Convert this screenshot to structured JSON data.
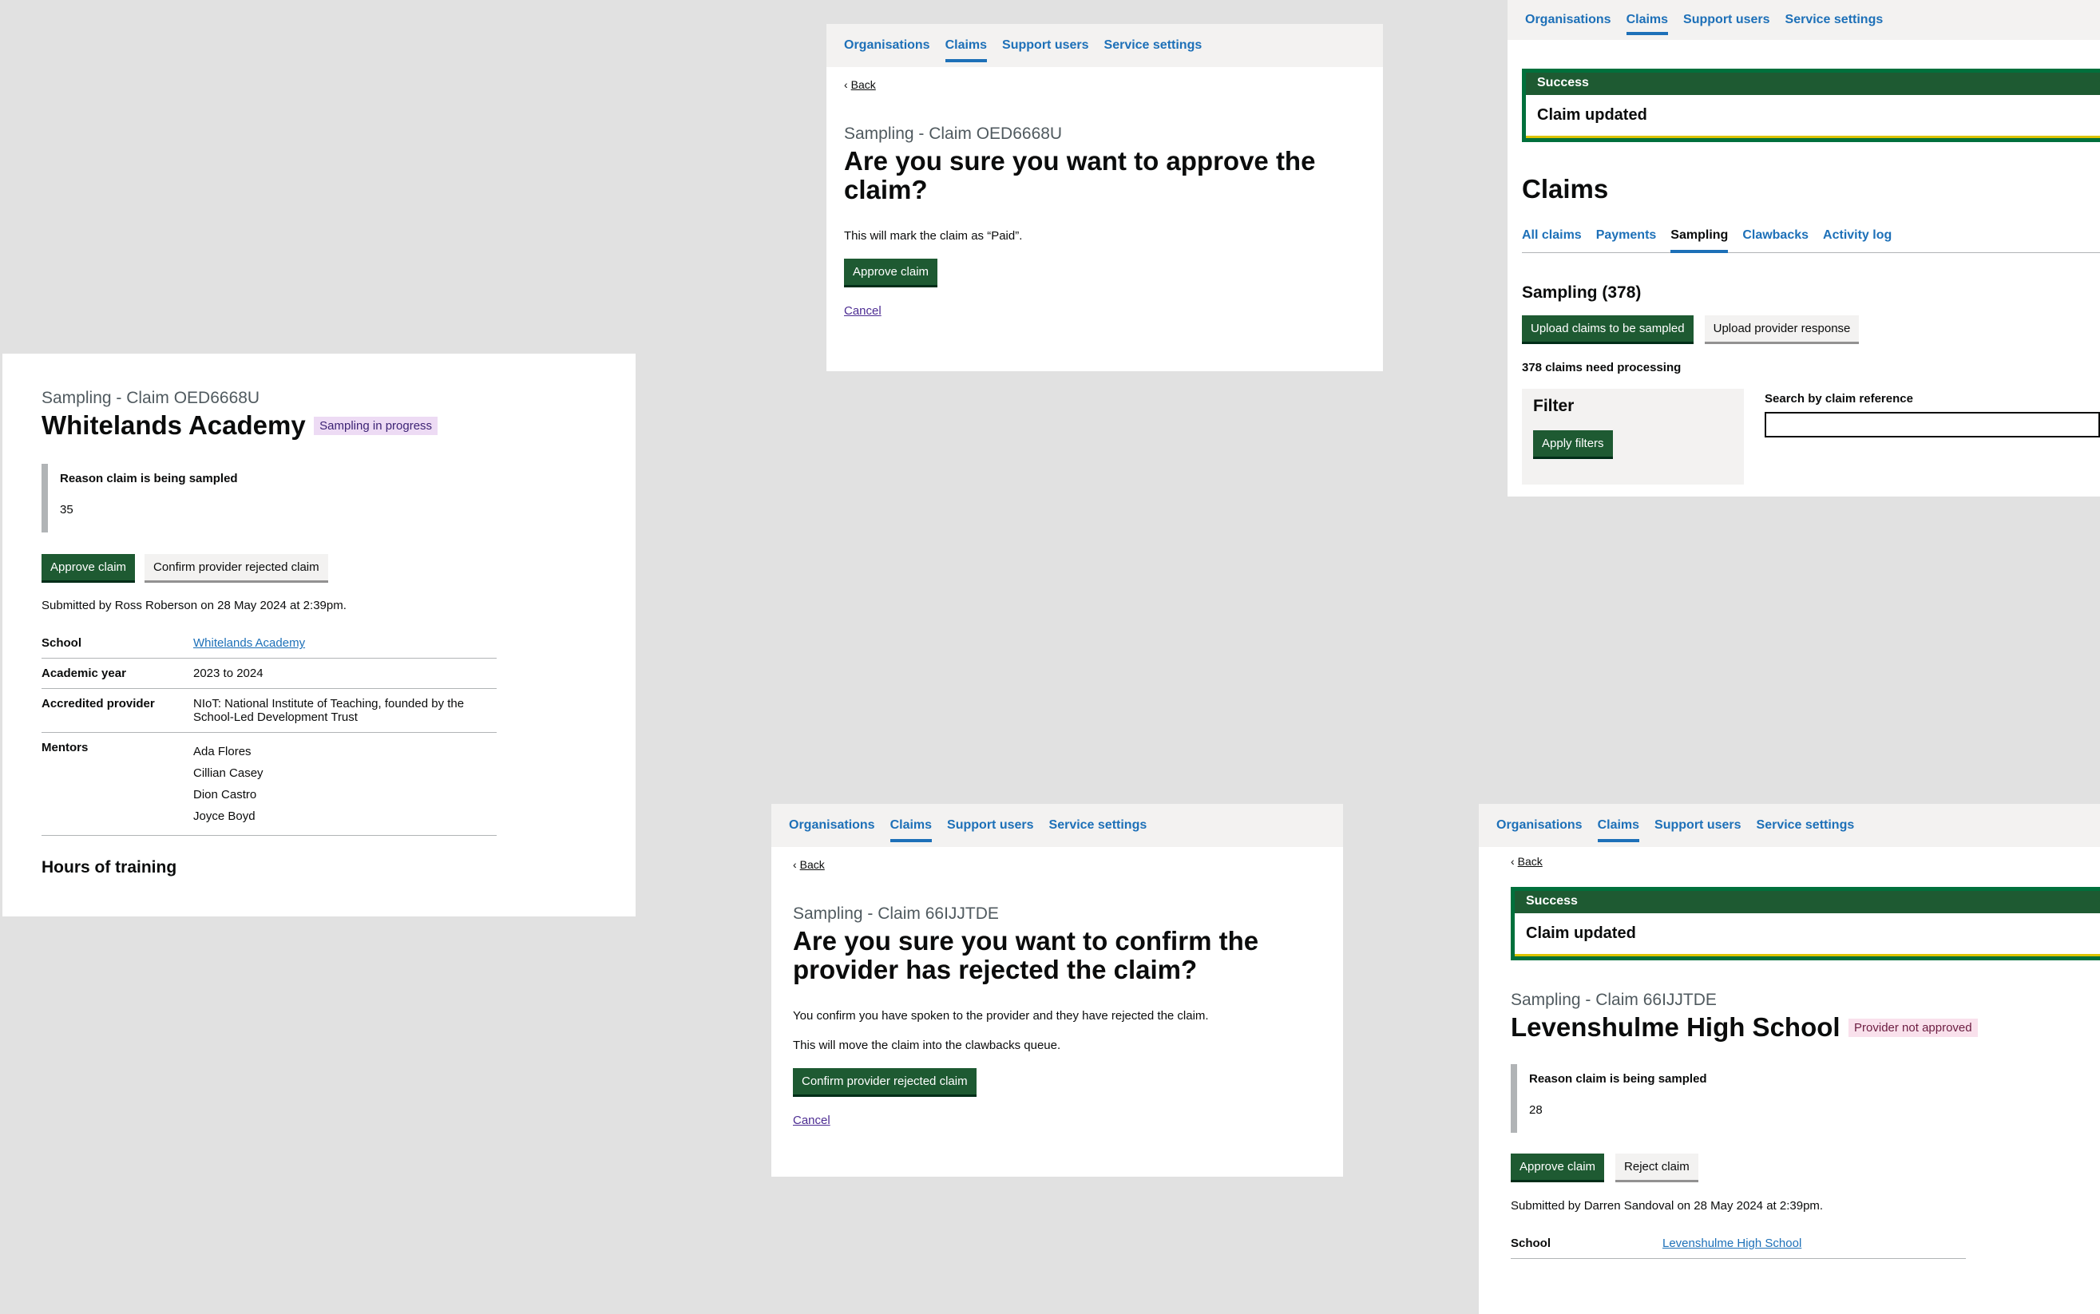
{
  "nav": {
    "organisations": "Organisations",
    "claims": "Claims",
    "support_users": "Support users",
    "service_settings": "Service settings"
  },
  "claim_detail_1": {
    "caption": "Sampling - Claim OED6668U",
    "title": "Whitelands Academy",
    "status_tag": "Sampling in progress",
    "reason_heading": "Reason claim is being sampled",
    "reason_value": "35",
    "approve_label": "Approve claim",
    "reject_label": "Confirm provider rejected claim",
    "submitted": "Submitted by Ross Roberson on 28 May 2024 at 2:39pm.",
    "rows": [
      {
        "key": "School",
        "value": "Whitelands Academy"
      },
      {
        "key": "Academic year",
        "value": "2023 to 2024"
      },
      {
        "key": "Accredited provider",
        "value": "NIoT: National Institute of Teaching, founded by the School-Led Development Trust"
      },
      {
        "key": "Mentors",
        "values": [
          "Ada Flores",
          "Cillian Casey",
          "Dion Castro",
          "Joyce Boyd"
        ]
      }
    ],
    "hours_heading": "Hours of training"
  },
  "approve_confirm": {
    "back": "Back",
    "caption": "Sampling - Claim OED6668U",
    "title": "Are you sure you want to approve the claim?",
    "body": "This will mark the claim as “Paid”.",
    "button": "Approve claim",
    "cancel": "Cancel"
  },
  "claims_list": {
    "banner_title": "Success",
    "banner_body": "Claim updated",
    "heading": "Claims",
    "tabs": [
      "All claims",
      "Payments",
      "Sampling",
      "Clawbacks",
      "Activity log"
    ],
    "active_tab": "Sampling",
    "section_heading": "Sampling (378)",
    "upload_sampled": "Upload claims to be sampled",
    "upload_response": "Upload provider response",
    "count_text": "378 claims need processing",
    "filter_heading": "Filter",
    "apply_filters": "Apply filters",
    "search_label": "Search by claim reference",
    "search_value": ""
  },
  "reject_confirm": {
    "back": "Back",
    "caption": "Sampling - Claim 66IJJTDE",
    "title": "Are you sure you want to confirm the provider has rejected the claim?",
    "body1": "You confirm you have spoken to the provider and they have rejected the claim.",
    "body2": "This will move the claim into the clawbacks queue.",
    "button": "Confirm provider rejected claim",
    "cancel": "Cancel"
  },
  "claim_detail_2": {
    "back": "Back",
    "banner_title": "Success",
    "banner_body": "Claim updated",
    "caption": "Sampling - Claim 66IJJTDE",
    "title": "Levenshulme High School",
    "status_tag": "Provider not approved",
    "reason_heading": "Reason claim is being sampled",
    "reason_value": "28",
    "approve_label": "Approve claim",
    "reject_label": "Reject claim",
    "submitted": "Submitted by Darren Sandoval on 28 May 2024 at 2:39pm.",
    "school_key": "School",
    "school_value": "Levenshulme High School"
  }
}
